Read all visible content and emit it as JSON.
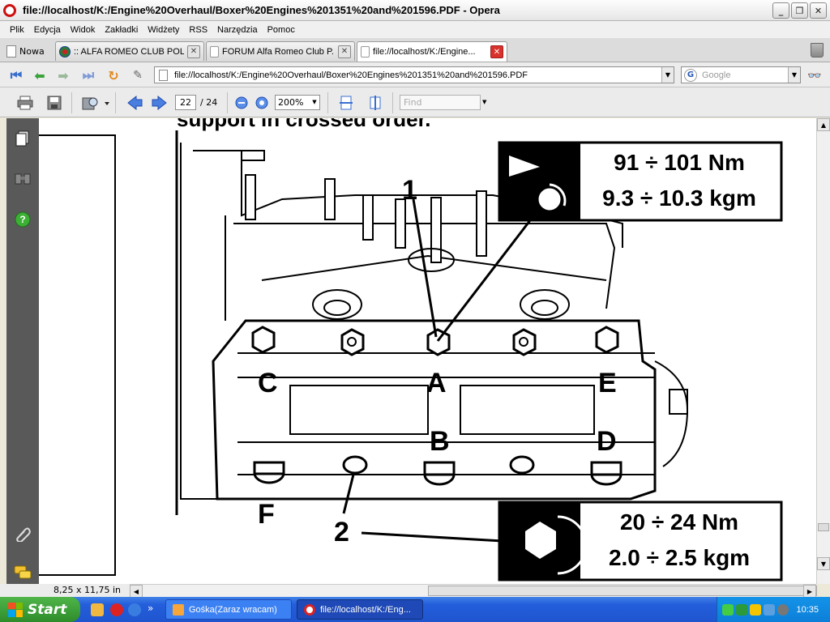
{
  "window": {
    "title": "file://localhost/K:/Engine%20Overhaul/Boxer%20Engines%201351%20and%201596.PDF - Opera",
    "buttons": [
      "_",
      "❐",
      "✕"
    ]
  },
  "menu": [
    "Plik",
    "Edycja",
    "Widok",
    "Zakładki",
    "Widżety",
    "RSS",
    "Narzędzia",
    "Pomoc"
  ],
  "tabs": {
    "new_label": "Nowa",
    "items": [
      {
        "label": ":: ALFA ROMEO CLUB POL...",
        "icon": "alfa-romeo-icon",
        "active": false
      },
      {
        "label": "FORUM Alfa Romeo Club P...",
        "icon": "page-icon",
        "active": false
      },
      {
        "label": "file://localhost/K:/Engine...",
        "icon": "page-icon",
        "active": true
      }
    ]
  },
  "address": {
    "url": "file://localhost/K:/Engine%20Overhaul/Boxer%20Engines%201351%20and%201596.PDF",
    "search_placeholder": "Google"
  },
  "pdf_toolbar": {
    "page_current": "22",
    "page_total": "/ 24",
    "zoom": "200%",
    "find_placeholder": "Find"
  },
  "document": {
    "top_text": "support in crossed order.",
    "spec_top": {
      "line1": "91 ÷ 101 Nm",
      "line2": "9.3 ÷ 10.3 kgm"
    },
    "spec_bottom": {
      "line1": "20 ÷ 24 Nm",
      "line2": "2.0 ÷ 2.5 kgm"
    },
    "labels": {
      "A": "A",
      "B": "B",
      "C": "C",
      "D": "D",
      "E": "E",
      "F": "F",
      "n1": "1",
      "n2": "2"
    }
  },
  "status": {
    "page_size": "8,25 x 11,75 in"
  },
  "taskbar": {
    "start": "Start",
    "buttons": [
      {
        "label": "Gośka(Zaraz wracam)",
        "active": false
      },
      {
        "label": "file://localhost/K:/Eng...",
        "active": true
      }
    ],
    "clock": "10:35"
  }
}
